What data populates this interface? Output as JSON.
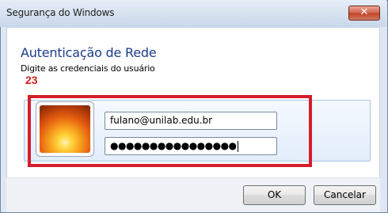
{
  "window": {
    "title": "Segurança do Windows",
    "close_glyph": "✕"
  },
  "dialog": {
    "heading": "Autenticação de Rede",
    "subheading": "Digite as credenciais do usuário",
    "annotation_number": "23"
  },
  "credentials": {
    "user_icon": "user-picture-flower-icon",
    "username_value": "fulano@unilab.edu.br",
    "password_masked": "●●●●●●●●●●●●●●●●"
  },
  "buttons": {
    "ok_label": "OK",
    "cancel_label": "Cancelar"
  },
  "colors": {
    "heading": "#1c3c8c",
    "annotation": "#d51e2a",
    "tile": "#e3eefb"
  }
}
